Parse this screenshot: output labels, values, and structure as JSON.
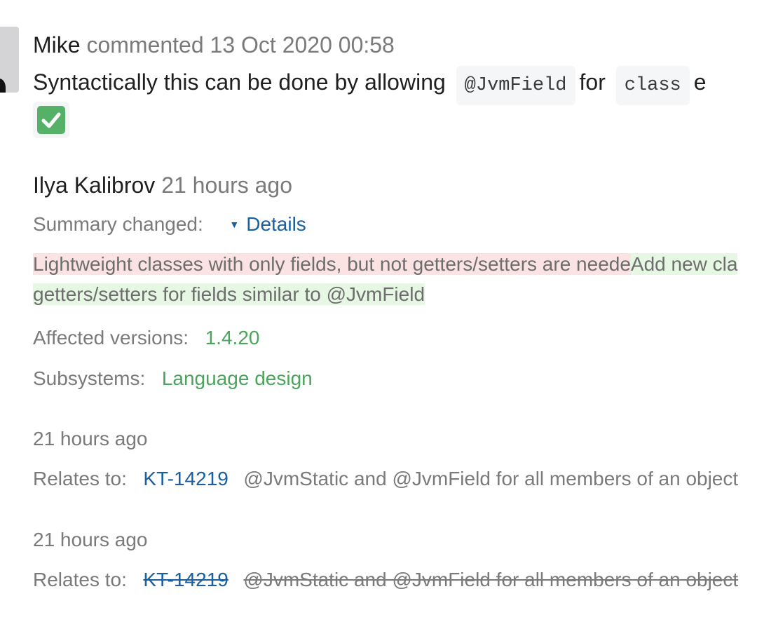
{
  "comment": {
    "author": "Mike",
    "meta": "commented 13 Oct 2020 00:58",
    "body_prefix": "Syntactically this can be done by allowing",
    "code_1": "@JvmField",
    "body_mid": "for",
    "code_2": "class",
    "body_tail": "e",
    "reaction_icon": "check-mark-icon",
    "reaction_color": "#55b068"
  },
  "activity": {
    "author": "Ilya Kalibrov",
    "time": "21 hours ago",
    "summary_label": "Summary changed:",
    "details_label": "Details",
    "removed_text": "Lightweight classes with only fields, but not getters/setters are neede",
    "added_text_line1": "Add new cla",
    "added_text_line2": "getters/setters for fields similar to @JvmField",
    "affected_label": "Affected versions:",
    "affected_value": "1.4.20",
    "subsystems_label": "Subsystems:",
    "subsystems_value": "Language design"
  },
  "events": [
    {
      "time": "21 hours ago",
      "relates_label": "Relates to:",
      "issue_id": "KT-14219",
      "issue_title": "@JvmStatic and @JvmField for all members of an object",
      "struck": false
    },
    {
      "time": "21 hours ago",
      "relates_label": "Relates to:",
      "issue_id": "KT-14219",
      "issue_title": "@JvmStatic and @JvmField for all members of an object",
      "struck": true
    }
  ]
}
